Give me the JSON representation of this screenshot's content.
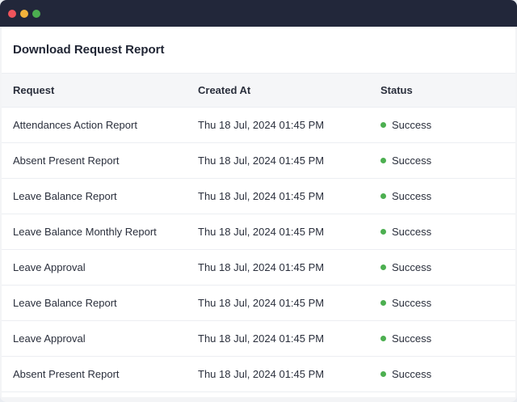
{
  "window": {
    "controls": [
      {
        "name": "close",
        "color": "#f0545c"
      },
      {
        "name": "minimize",
        "color": "#f3b33b"
      },
      {
        "name": "maximize",
        "color": "#4caf50"
      }
    ]
  },
  "panel": {
    "title": "Download Request Report"
  },
  "table": {
    "headers": {
      "request": "Request",
      "created_at": "Created At",
      "status": "Status"
    },
    "status_color": "#4caf50",
    "rows": [
      {
        "request": "Attendances Action Report",
        "created_at": "Thu 18 Jul, 2024 01:45 PM",
        "status": "Success"
      },
      {
        "request": "Absent Present Report",
        "created_at": "Thu 18 Jul, 2024 01:45 PM",
        "status": "Success"
      },
      {
        "request": "Leave Balance Report",
        "created_at": "Thu 18 Jul, 2024 01:45 PM",
        "status": "Success"
      },
      {
        "request": "Leave Balance Monthly Report",
        "created_at": "Thu 18 Jul, 2024 01:45 PM",
        "status": "Success"
      },
      {
        "request": "Leave Approval",
        "created_at": "Thu 18 Jul, 2024 01:45 PM",
        "status": "Success"
      },
      {
        "request": "Leave Balance Report",
        "created_at": "Thu 18 Jul, 2024 01:45 PM",
        "status": "Success"
      },
      {
        "request": "Leave Approval",
        "created_at": "Thu 18 Jul, 2024 01:45 PM",
        "status": "Success"
      },
      {
        "request": "Absent Present Report",
        "created_at": "Thu 18 Jul, 2024 01:45 PM",
        "status": "Success"
      }
    ]
  }
}
